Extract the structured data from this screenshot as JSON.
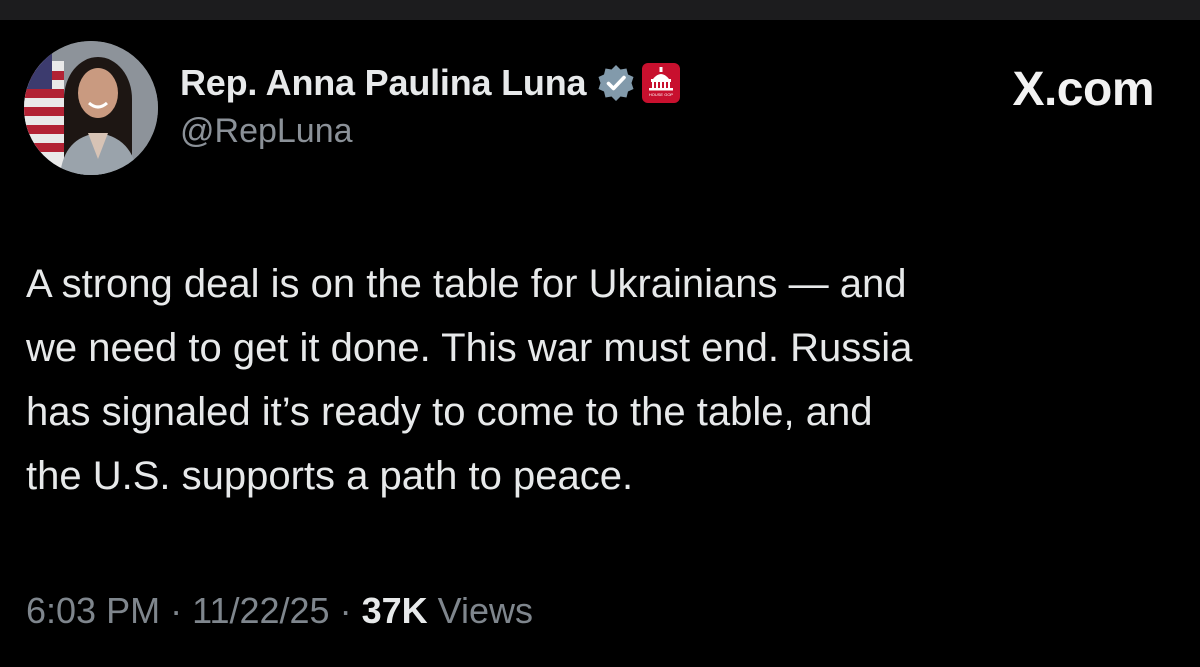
{
  "author": {
    "display_name": "Rep. Anna Paulina Luna",
    "handle": "@RepLuna",
    "verified_icon": "verified-badge-icon",
    "affiliation_badge_icon": "house-gop-capitol-icon",
    "affiliation_badge_text": "HOUSE GOP",
    "avatar": "profile-photo"
  },
  "site_mark": "X.com",
  "tweet": {
    "lines": [
      "A strong deal is on the table for Ukrainians — and",
      "we need to get it done. This war must end. Russia",
      "has signaled it’s ready to come to the table, and",
      "the U.S. supports a path to peace."
    ]
  },
  "meta": {
    "time": "6:03 PM",
    "separator": "·",
    "date": "11/22/25",
    "views_count": "37K",
    "views_label": "Views"
  },
  "colors": {
    "background": "#000000",
    "text_primary": "#e7e9ea",
    "text_secondary": "#7f868d",
    "verified_gray": "#829aab",
    "badge_red": "#c8102e"
  }
}
